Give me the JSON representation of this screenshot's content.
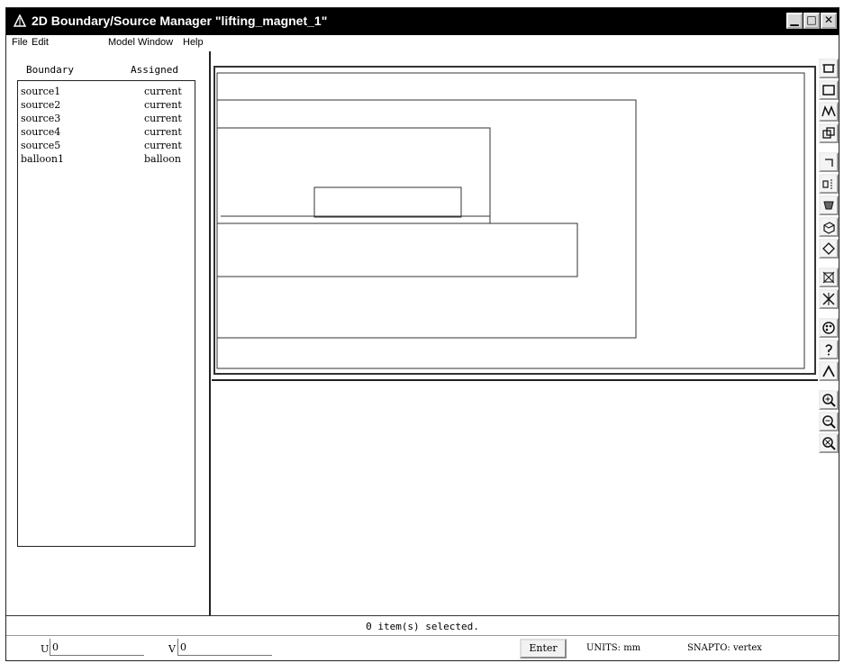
{
  "window": {
    "title": "2D Boundary/Source Manager \"lifting_magnet_1\""
  },
  "menu": {
    "file": "File",
    "edit": "Edit",
    "model": "Model",
    "window": "Window",
    "help": "Help"
  },
  "list": {
    "col_boundary": "Boundary",
    "col_assigned": "Assigned",
    "rows": [
      {
        "name": "source1",
        "type": "current"
      },
      {
        "name": "source2",
        "type": "current"
      },
      {
        "name": "source3",
        "type": "current"
      },
      {
        "name": "source4",
        "type": "current"
      },
      {
        "name": "source5",
        "type": "current"
      },
      {
        "name": "balloon1",
        "type": "balloon"
      }
    ]
  },
  "status": {
    "selected": "0 item(s) selected."
  },
  "bottom": {
    "u_label": "U",
    "u_value": "0",
    "v_label": "V",
    "v_value": "0",
    "enter": "Enter",
    "units": "UNITS: mm",
    "snapto": "SNAPTO: vertex"
  },
  "toolbar_icons": [
    "rectangle-tool-icon",
    "square-tool-icon",
    "polyline-tool-icon",
    "overlap-icon",
    "edge-icon",
    "split-icon",
    "fill-icon",
    "box3d-icon",
    "diamond-icon",
    "cross-box-icon",
    "cross-star-icon",
    "palette-icon",
    "help-icon",
    "arc-icon",
    "zoom-in-icon",
    "zoom-out-icon",
    "zoom-fit-icon"
  ]
}
